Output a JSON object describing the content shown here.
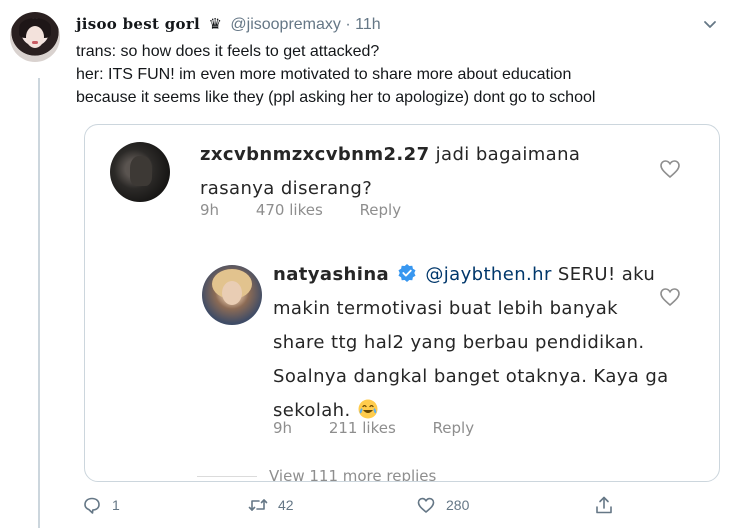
{
  "tweet": {
    "display_name": "jisoo best gorl",
    "crown_icon": "♛",
    "handle": "@jisoopremaxy",
    "dot": "·",
    "time": "11h",
    "lines": [
      "trans: so how does it feels to get attacked?",
      "her: ITS FUN! im even more motivated to share more about education",
      "because it seems like they (ppl asking her to apologize) dont go to school"
    ]
  },
  "embedded": {
    "comment1": {
      "username": "zxcvbnmzxcvbnm2.27",
      "text": "jadi bagaimana rasanya diserang?",
      "time": "9h",
      "likes": "470 likes",
      "reply": "Reply"
    },
    "comment2": {
      "username": "natyashina",
      "mention": "@jaybthen.hr",
      "text": "SERU! aku makin termotivasi buat lebih banyak share ttg hal2 yang berbau pendidikan. Soalnya dangkal banget otaknya. Kaya ga sekolah.",
      "emoji": "joy-emoji",
      "time": "9h",
      "likes": "211 likes",
      "reply": "Reply"
    },
    "view_more": "View 111 more replies"
  },
  "actions": {
    "reply_count": "1",
    "retweet_count": "42",
    "like_count": "280"
  },
  "colors": {
    "text": "#14171a",
    "secondary": "#657786",
    "border": "#ccd6dd",
    "verified": "#3897f0",
    "ig_mention": "#00376b"
  }
}
